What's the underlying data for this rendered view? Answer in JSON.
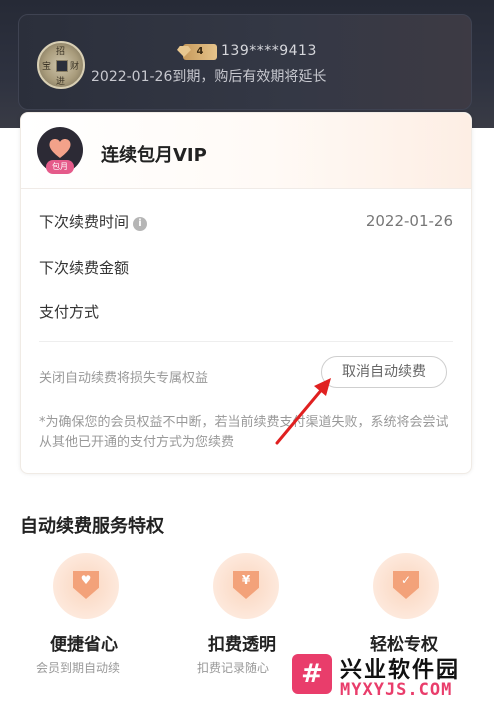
{
  "member": {
    "coin_glyphs": [
      "招",
      "宝",
      "财",
      "进"
    ],
    "badge_level": "4",
    "phone": "139****9413",
    "expiry_text": "2022-01-26到期，购后有效期将延长"
  },
  "plan": {
    "icon_tag": "包月",
    "title": "连续包月VIP",
    "rows": [
      {
        "label": "下次续费时间",
        "value": "2022-01-26"
      },
      {
        "label": "下次续费金额",
        "value": ""
      },
      {
        "label": "支付方式",
        "value": ""
      }
    ],
    "warning": "关闭自动续费将损失专属权益",
    "cancel_label": "取消自动续费",
    "note": "*为确保您的会员权益不中断，若当前续费支付渠道失败，系统将会尝试从其他已开通的支付方式为您续费"
  },
  "privileges": {
    "title": "自动续费服务特权",
    "items": [
      {
        "name": "便捷省心",
        "desc": "会员到期自动续",
        "glyph": "♥"
      },
      {
        "name": "扣费透明",
        "desc": "扣费记录随心",
        "glyph": "¥"
      },
      {
        "name": "轻松专权",
        "desc": "",
        "glyph": "✓"
      }
    ]
  },
  "watermark": {
    "logo": "#",
    "title": "兴业软件园",
    "url": "MYXYJS.COM"
  },
  "colors": {
    "accent": "#f3a27a",
    "header_bg": "#262a36",
    "brand_pink": "#e93d6b",
    "arrow_red": "#e02020"
  }
}
